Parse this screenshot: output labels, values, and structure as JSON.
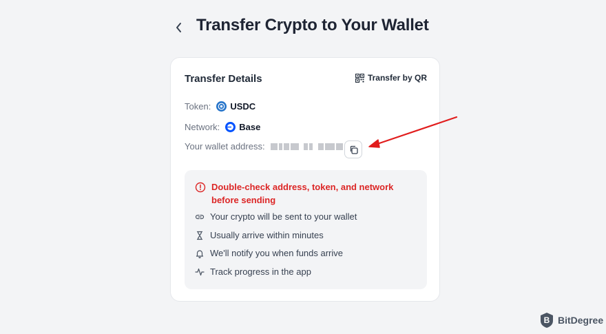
{
  "header": {
    "title": "Transfer Crypto to Your Wallet"
  },
  "card": {
    "title": "Transfer Details",
    "qr_label": "Transfer by QR",
    "token_label": "Token:",
    "token_value": "USDC",
    "network_label": "Network:",
    "network_value": "Base",
    "wallet_label": "Your wallet address:"
  },
  "info": {
    "warning": "Double-check address, token, and network before sending",
    "items": [
      "Your crypto will be sent to your wallet",
      "Usually arrive within minutes",
      "We'll notify you when funds arrive",
      "Track progress in the app"
    ]
  },
  "colors": {
    "warning": "#dc2626",
    "usdc": "#2775ca",
    "base": "#0052ff",
    "annotation_arrow": "#e11d1d"
  },
  "watermark": {
    "text": "BitDegree"
  }
}
